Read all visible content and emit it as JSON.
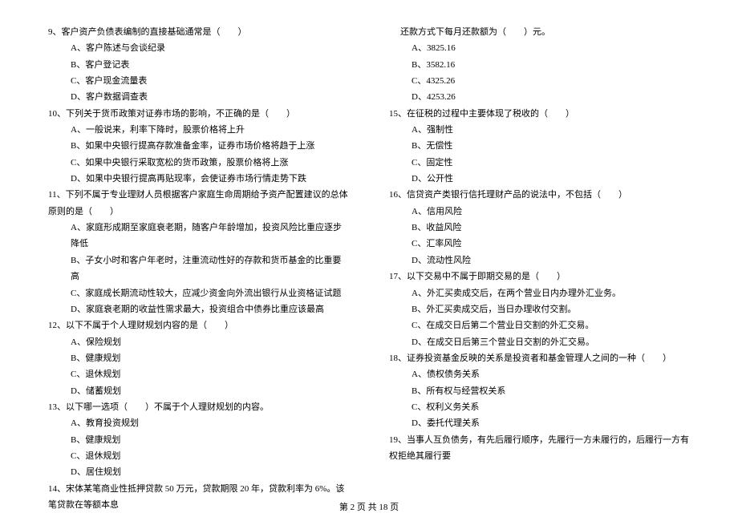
{
  "left": {
    "q9": {
      "stem": "9、客户资产负债表编制的直接基础通常是（　　）",
      "a": "A、客户陈述与会谈纪录",
      "b": "B、客户登记表",
      "c": "C、客户现金流量表",
      "d": "D、客户数据调查表"
    },
    "q10": {
      "stem": "10、下列关于货币政策对证券市场的影响，不正确的是（　　）",
      "a": "A、一般说来，利率下降时，股票价格将上升",
      "b": "B、如果中央银行提高存款准备金率，证券市场价格将趋于上涨",
      "c": "C、如果中央银行采取宽松的货币政策，股票价格将上涨",
      "d": "D、如果中央银行提高再贴现率，会使证券市场行情走势下跌"
    },
    "q11": {
      "stem": "11、下列不属于专业理财人员根据客户家庭生命周期给予资产配置建议的总体原则的是（　　）",
      "a": "A、家庭形成期至家庭衰老期，随客户年龄增加，投资风险比重应逐步降低",
      "b": "B、子女小时和客户年老时，注重流动性好的存款和货币基金的比重要高",
      "c": "C、家庭成长期流动性较大，应减少资金向外流出银行从业资格证试题",
      "d": "D、家庭衰老期的收益性需求最大，投资组合中债券比重应该最高"
    },
    "q12": {
      "stem": "12、以下不属于个人理财规划内容的是（　　）",
      "a": "A、保险规划",
      "b": "B、健康规划",
      "c": "C、退休规划",
      "d": "D、储蓄规划"
    },
    "q13": {
      "stem": "13、以下哪一选项（　　）不属于个人理财规划的内容。",
      "a": "A、教育投资规划",
      "b": "B、健康规划",
      "c": "C、退休规划",
      "d": "D、居住规划"
    },
    "q14": {
      "stem": "14、宋体某笔商业性抵押贷款 50 万元，贷款期限 20 年，贷款利率为 6%。该笔贷款在等额本息"
    }
  },
  "right": {
    "cont": "还款方式下每月还款额为（　　）元。",
    "q14opts": {
      "a": "A、3825.16",
      "b": "B、3582.16",
      "c": "C、4325.26",
      "d": "D、4253.26"
    },
    "q15": {
      "stem": "15、在征税的过程中主要体现了税收的（　　）",
      "a": "A、强制性",
      "b": "B、无偿性",
      "c": "C、固定性",
      "d": "D、公开性"
    },
    "q16": {
      "stem": "16、信贷资产类银行信托理财产品的说法中，不包括（　　）",
      "a": "A、信用风险",
      "b": "B、收益风险",
      "c": "C、汇率风险",
      "d": "D、流动性风险"
    },
    "q17": {
      "stem": "17、以下交易中不属于即期交易的是（　　）",
      "a": "A、外汇买卖成交后，在两个营业日内办理外汇业务。",
      "b": "B、外汇买卖成交后，当日办理收付交割。",
      "c": "C、在成交日后第二个营业日交割的外汇交易。",
      "d": "D、在成交日后第三个营业日交割的外汇交易。"
    },
    "q18": {
      "stem": "18、证券投资基金反映的关系是投资者和基金管理人之间的一种（　　）",
      "a": "A、债权债务关系",
      "b": "B、所有权与经营权关系",
      "c": "C、权利义务关系",
      "d": "D、委托代理关系"
    },
    "q19": {
      "stem": "19、当事人互负债务，有先后履行顺序，先履行一方未履行的，后履行一方有权拒绝其履行要"
    }
  },
  "footer": "第 2 页 共 18 页"
}
